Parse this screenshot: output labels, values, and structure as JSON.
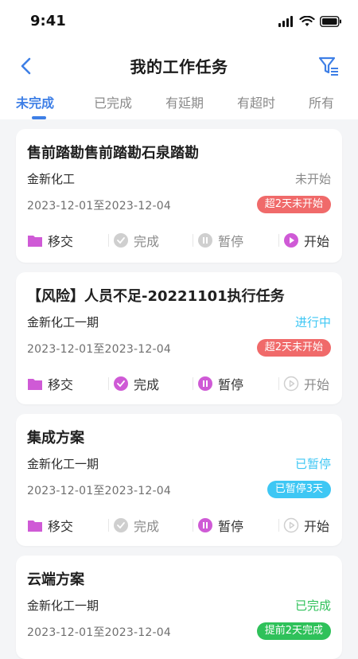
{
  "status_bar": {
    "time": "9:41"
  },
  "nav": {
    "title": "我的工作任务"
  },
  "tabs": [
    {
      "label": "未完成"
    },
    {
      "label": "已完成"
    },
    {
      "label": "有延期"
    },
    {
      "label": "有超时"
    },
    {
      "label": "所有"
    }
  ],
  "colors": {
    "primary": "#3e7fe6",
    "purple": "#cf5ad6",
    "disabled": "#cfcfcf",
    "badge_red": "#f06a6a",
    "badge_blue": "#3ec7f4",
    "badge_green": "#2fc15a",
    "status_gray": "#8a8a8a",
    "status_blue": "#3ec7f4",
    "status_green": "#2fc15a"
  },
  "actions": {
    "transfer": "移交",
    "complete": "完成",
    "pause": "暂停",
    "start": "开始"
  },
  "tasks": [
    {
      "title": "售前踏勘售前踏勘石泉踏勘",
      "org": "金新化工",
      "status": "未开始",
      "date_range": "2023-12-01至2023-12-04",
      "badge": "超2天未开始"
    },
    {
      "title": "【风险】人员不足-20221101执行任务",
      "org": "金新化工一期",
      "status": "进行中",
      "date_range": "2023-12-01至2023-12-04",
      "badge": "超2天未开始"
    },
    {
      "title": "集成方案",
      "org": "金新化工一期",
      "status": "已暂停",
      "date_range": "2023-12-01至2023-12-04",
      "badge": "已暂停3天"
    },
    {
      "title": "云端方案",
      "org": "金新化工一期",
      "status": "已完成",
      "date_range": "2023-12-01至2023-12-04",
      "badge": "提前2天完成"
    }
  ]
}
